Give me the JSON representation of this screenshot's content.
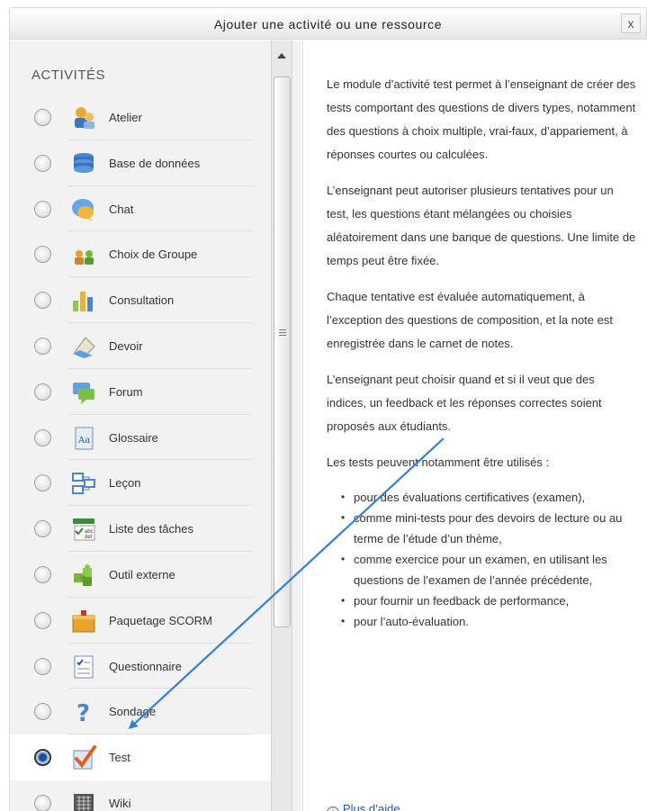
{
  "dialog": {
    "title": "Ajouter une activité ou une ressource",
    "close_label": "x"
  },
  "activities": {
    "section_title": "ACTIVITÉS",
    "items": [
      {
        "label": "Atelier",
        "icon": "workshop-icon",
        "selected": false
      },
      {
        "label": "Base de données",
        "icon": "database-icon",
        "selected": false
      },
      {
        "label": "Chat",
        "icon": "chat-icon",
        "selected": false
      },
      {
        "label": "Choix de Groupe",
        "icon": "group-choice-icon",
        "selected": false
      },
      {
        "label": "Consultation",
        "icon": "feedback-chart-icon",
        "selected": false
      },
      {
        "label": "Devoir",
        "icon": "assignment-icon",
        "selected": false
      },
      {
        "label": "Forum",
        "icon": "forum-icon",
        "selected": false
      },
      {
        "label": "Glossaire",
        "icon": "glossary-icon",
        "selected": false
      },
      {
        "label": "Leçon",
        "icon": "lesson-icon",
        "selected": false
      },
      {
        "label": "Liste des tâches",
        "icon": "checklist-icon",
        "selected": false
      },
      {
        "label": "Outil externe",
        "icon": "puzzle-icon",
        "selected": false
      },
      {
        "label": "Paquetage SCORM",
        "icon": "scorm-package-icon",
        "selected": false
      },
      {
        "label": "Questionnaire",
        "icon": "questionnaire-icon",
        "selected": false
      },
      {
        "label": "Sondage",
        "icon": "survey-question-icon",
        "selected": false
      },
      {
        "label": "Test",
        "icon": "quiz-check-icon",
        "selected": true
      },
      {
        "label": "Wiki",
        "icon": "wiki-icon",
        "selected": false
      }
    ]
  },
  "description": {
    "paragraphs": [
      "Le module d’activité test permet à l’enseignant de créer des tests comportant des questions de divers types, notamment des questions à choix multiple, vrai-faux, d’appariement, à réponses courtes ou calculées.",
      "L’enseignant peut autoriser plusieurs tentatives pour un test, les questions étant mélangées ou choisies aléatoirement dans une banque de questions. Une limite de temps peut être fixée.",
      "Chaque tentative est évaluée automatiquement, à l’exception des questions de composition, et la note est enregistrée dans le carnet de notes.",
      "L’enseignant peut choisir quand et si il veut que des indices, un feedback et les réponses correctes soient proposés aux étudiants.",
      "Les tests peuvent notamment être utilisés :"
    ],
    "bullets": [
      "pour des évaluations certificatives (examen),",
      "comme mini-tests pour des devoirs de lecture ou au terme de l’étude d’un thème,",
      "comme exercice pour un examen, en utilisant les questions de l’examen de l’année précédente,",
      "pour fournir un feedback de performance,",
      "pour l’auto-évaluation."
    ],
    "help_link": "Plus d’aide",
    "help_icon": "info-circle-icon"
  },
  "colors": {
    "arrow": "#2f7fe0",
    "link": "#1a5aa6",
    "panel_bg": "#f2f2f2"
  }
}
